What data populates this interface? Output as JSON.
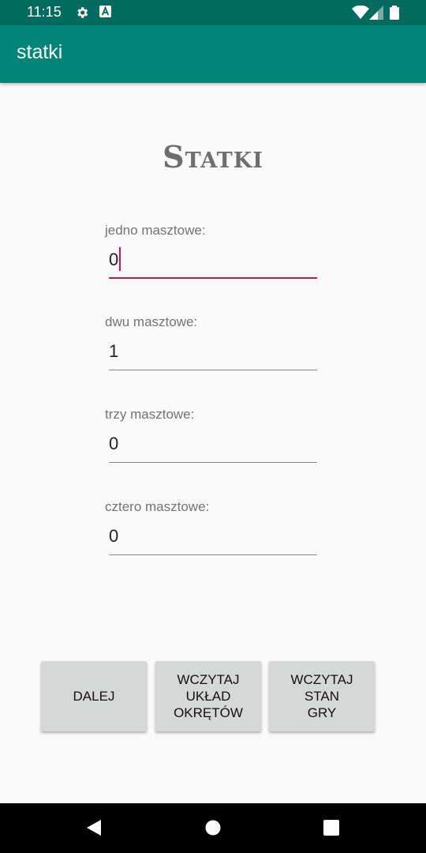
{
  "status_bar": {
    "time": "11:15",
    "icons": [
      "settings-gear-icon",
      "accessibility-a-icon",
      "wifi-icon",
      "signal-icon",
      "battery-icon"
    ]
  },
  "app_bar": {
    "title": "statki"
  },
  "heading": "Statki",
  "fields": [
    {
      "label": "jedno masztowe:",
      "value": "0",
      "focused": true
    },
    {
      "label": "dwu masztowe:",
      "value": "1",
      "focused": false
    },
    {
      "label": "trzy masztowe:",
      "value": "0",
      "focused": false
    },
    {
      "label": "cztero masztowe:",
      "value": "0",
      "focused": false
    }
  ],
  "buttons": [
    {
      "label": "DALEJ"
    },
    {
      "label": "WCZYTAJ\nUKŁAD\nOKRĘTÓW"
    },
    {
      "label": "WCZYTAJ\nSTAN\nGRY"
    }
  ],
  "nav_bar": {
    "icons": [
      "back-icon",
      "home-icon",
      "recents-icon"
    ]
  },
  "colors": {
    "primary": "#008577",
    "primary_dark": "#016b5e",
    "accent": "#c2185b"
  }
}
